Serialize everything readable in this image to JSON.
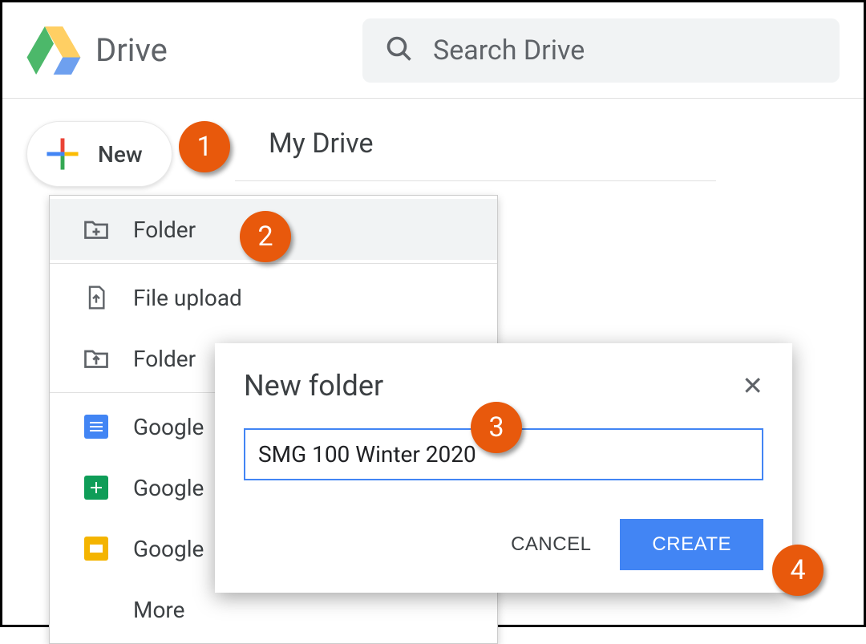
{
  "header": {
    "product_name": "Drive",
    "search_placeholder": "Search Drive"
  },
  "sidebar": {
    "new_label": "New"
  },
  "main": {
    "location": "My Drive"
  },
  "menu": {
    "folder": "Folder",
    "file_upload": "File upload",
    "folder_upload": "Folder",
    "docs": "Google",
    "sheets": "Google",
    "slides": "Google",
    "more": "More"
  },
  "dialog": {
    "title": "New folder",
    "input_value": "SMG 100 Winter 2020",
    "cancel": "CANCEL",
    "create": "CREATE"
  },
  "callouts": {
    "one": "1",
    "two": "2",
    "three": "3",
    "four": "4"
  }
}
